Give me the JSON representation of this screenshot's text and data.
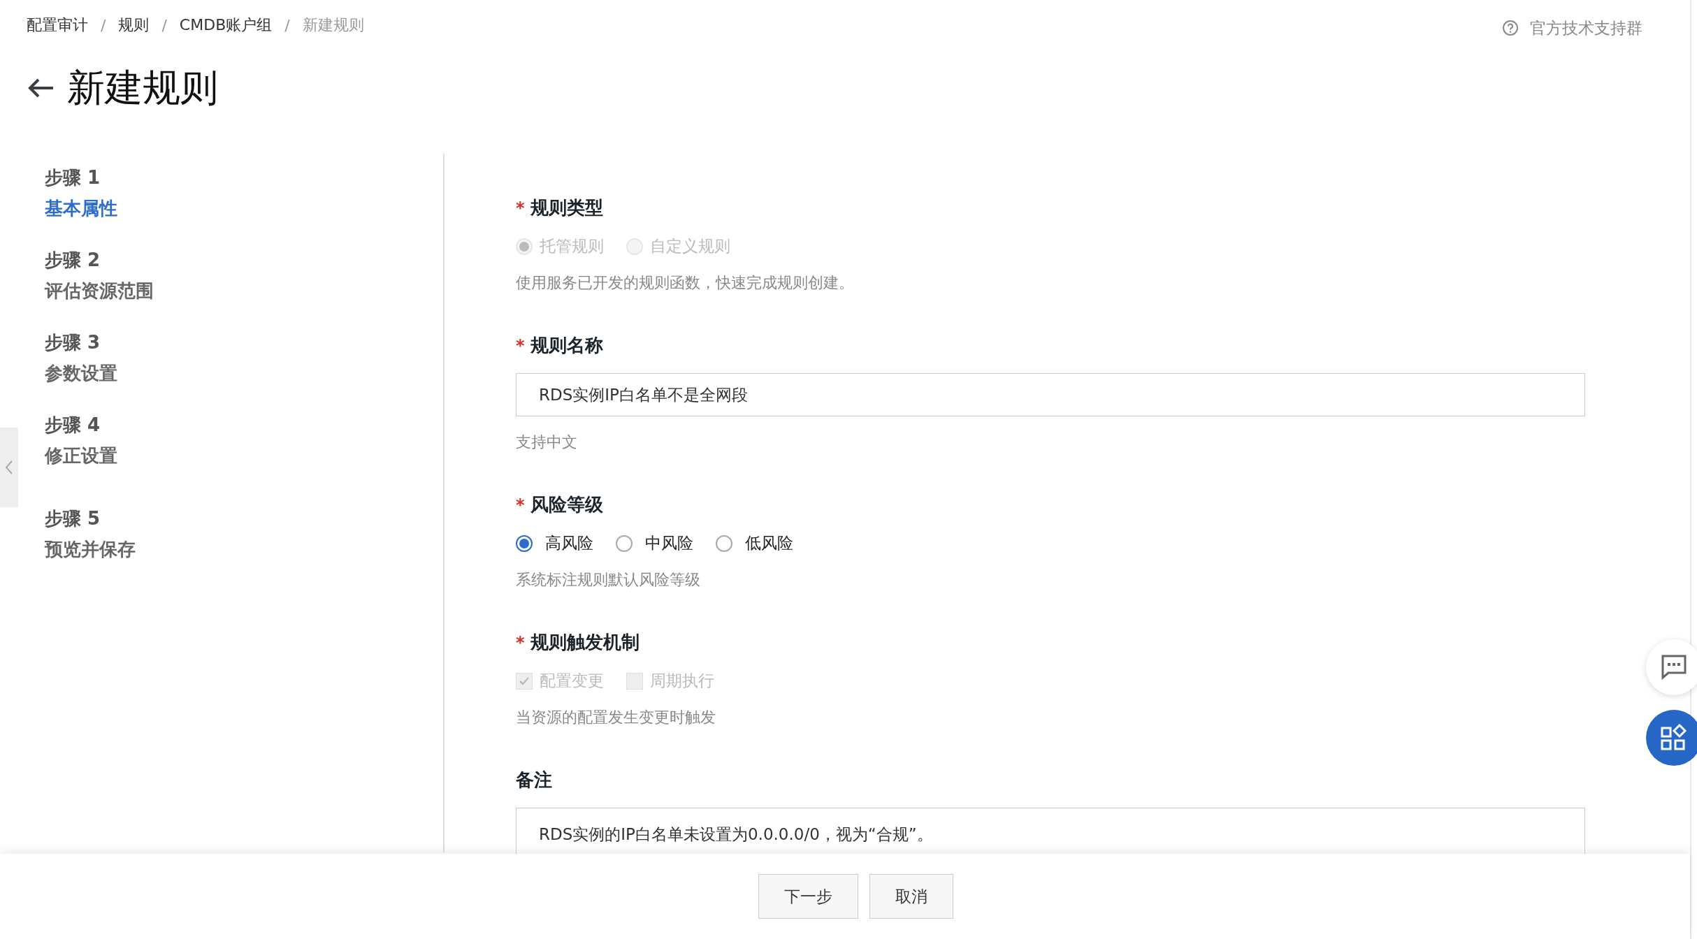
{
  "breadcrumb": [
    {
      "label": "配置审计",
      "current": false
    },
    {
      "label": "规则",
      "current": false
    },
    {
      "label": "CMDB账户组",
      "current": false
    },
    {
      "label": "新建规则",
      "current": true
    }
  ],
  "breadcrumb_separator": "/",
  "support_link": "官方技术支持群",
  "page_title": "新建规则",
  "steps": [
    {
      "step": "步骤 1",
      "name": "基本属性",
      "selected": true
    },
    {
      "step": "步骤 2",
      "name": "评估资源范围",
      "selected": false
    },
    {
      "step": "步骤 3",
      "name": "参数设置",
      "selected": false
    },
    {
      "step": "步骤 4",
      "name": "修正设置",
      "selected": false
    },
    {
      "step": "步骤 5",
      "name": "预览并保存",
      "selected": false
    }
  ],
  "fields": [
    {
      "kind": "radio",
      "label": "规则类型",
      "required": true,
      "disabled": true,
      "options": [
        {
          "label": "托管规则",
          "selected": true
        },
        {
          "label": "自定义规则",
          "selected": false
        }
      ],
      "help": "使用服务已开发的规则函数，快速完成规则创建。"
    },
    {
      "kind": "input",
      "label": "规则名称",
      "required": true,
      "value": "RDS实例IP白名单不是全网段",
      "help": "支持中文"
    },
    {
      "kind": "radio",
      "label": "风险等级",
      "required": true,
      "disabled": false,
      "options": [
        {
          "label": "高风险",
          "selected": true
        },
        {
          "label": "中风险",
          "selected": false
        },
        {
          "label": "低风险",
          "selected": false
        }
      ],
      "help": "系统标注规则默认风险等级"
    },
    {
      "kind": "checkbox",
      "label": "规则触发机制",
      "required": true,
      "disabled": true,
      "options": [
        {
          "label": "配置变更",
          "checked": true
        },
        {
          "label": "周期执行",
          "checked": false
        }
      ],
      "help": "当资源的配置发生变更时触发"
    },
    {
      "kind": "textarea",
      "label": "备注",
      "required": false,
      "value": "RDS实例的IP白名单未设置为0.0.0.0/0，视为“合规”。"
    }
  ],
  "required_mark": "*",
  "buttons": [
    {
      "label": "下一步"
    },
    {
      "label": "取消"
    }
  ]
}
